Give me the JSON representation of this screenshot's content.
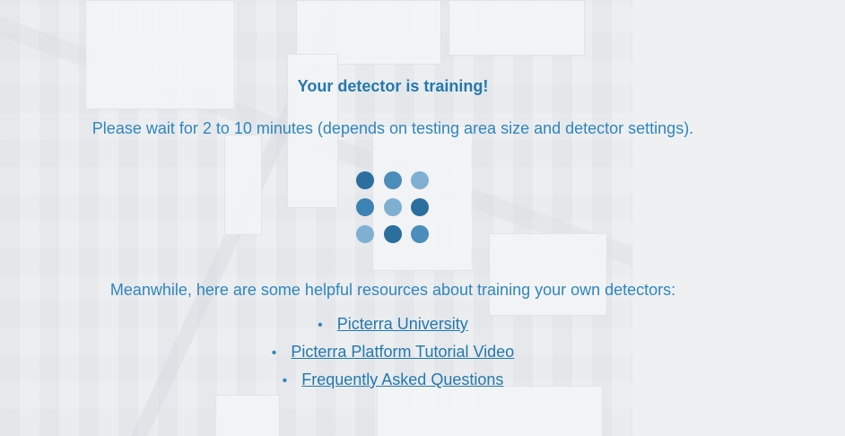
{
  "title": "Your detector is training!",
  "wait_message": "Please wait for 2 to 10 minutes (depends on testing area size and detector settings).",
  "meanwhile_message": "Meanwhile, here are some helpful resources about training your own detectors:",
  "resources": [
    {
      "label": "Picterra University"
    },
    {
      "label": "Picterra Platform Tutorial Video"
    },
    {
      "label": "Frequently Asked Questions"
    }
  ],
  "colors": {
    "text": "#2f86bd",
    "heading": "#2379ad",
    "dot_dark": "#2a6f9e",
    "dot_mid": "#4b8dbb",
    "dot_light": "#7fb0d2"
  },
  "spinner": {
    "icon": "loading-dots-grid-icon"
  }
}
